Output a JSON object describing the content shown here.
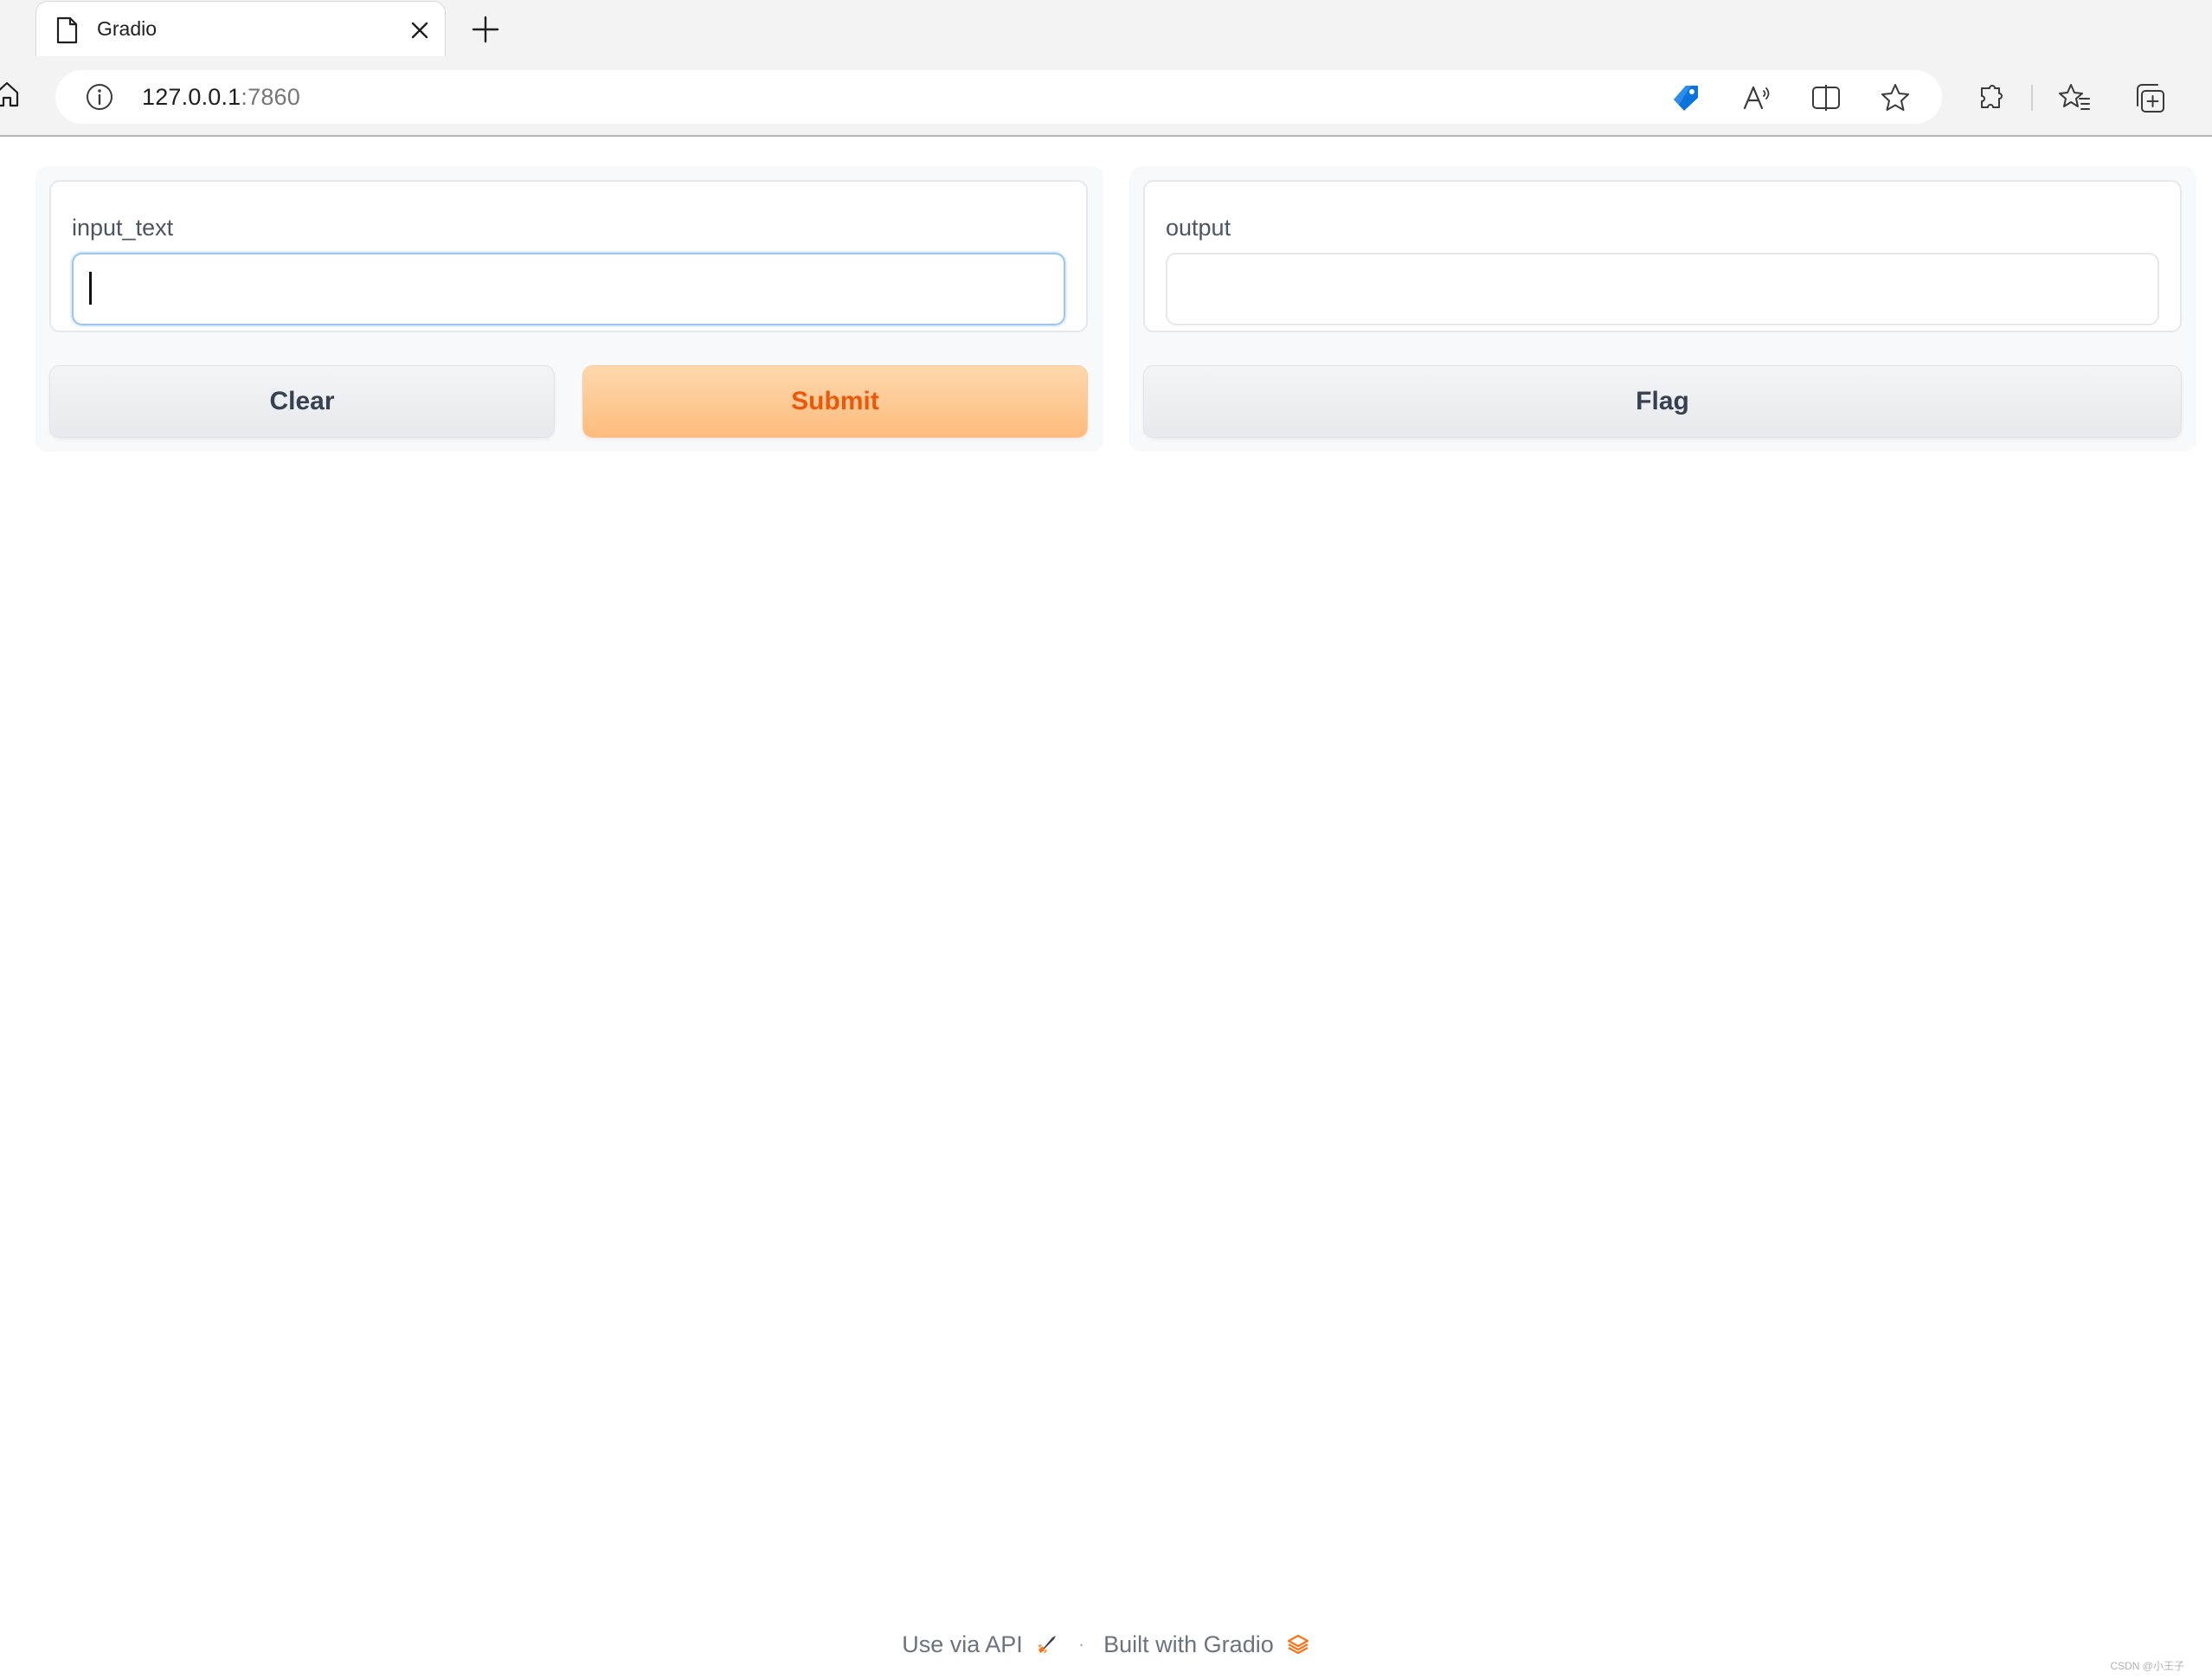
{
  "browser": {
    "tab": {
      "title": "Gradio",
      "icon": "page-icon"
    },
    "address": {
      "host": "127.0.0.1",
      "port": ":7860"
    },
    "toolbar_icons": [
      "home-icon",
      "site-info-icon",
      "shopping-tag-icon",
      "read-aloud-icon",
      "split-screen-icon",
      "favorite-star-icon",
      "extensions-icon",
      "favorites-icon",
      "collections-icon"
    ]
  },
  "app": {
    "input": {
      "label": "input_text",
      "value": ""
    },
    "output": {
      "label": "output",
      "value": ""
    },
    "buttons": {
      "clear": "Clear",
      "submit": "Submit",
      "flag": "Flag"
    }
  },
  "footer": {
    "api_link": "Use via API",
    "separator": "·",
    "built_with": "Built with Gradio"
  },
  "watermark": "CSDN @小王子",
  "colors": {
    "accent_text": "#ea580c",
    "primary_button_top": "#fed8ad",
    "primary_button_bottom": "#fdbc7c",
    "focus_border": "#9cc5ef",
    "brand_edge_blue": "#0a74da"
  }
}
